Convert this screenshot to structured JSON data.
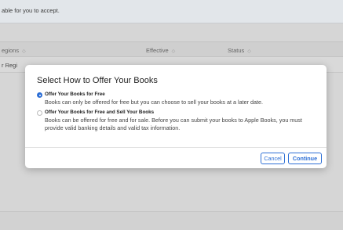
{
  "background": {
    "notice_text": "able for you to accept.",
    "columns": [
      {
        "label": "egions",
        "sort_icon": "◇"
      },
      {
        "label": "Effective",
        "sort_icon": "◇"
      },
      {
        "label": "Status",
        "sort_icon": "◇"
      }
    ],
    "row_stub_text": "r Regi"
  },
  "modal": {
    "title": "Select How to Offer Your Books",
    "options": [
      {
        "title": "Offer Your Books for Free",
        "description": "Books can only be offered for free but you can choose to sell your books at a later date.",
        "selected": true
      },
      {
        "title": "Offer Your Books for Free and Sell Your Books",
        "description": "Books can be offered for free and for sale. Before you can submit your books to Apple Books, you must provide valid banking details and valid tax information.",
        "selected": false
      }
    ],
    "cancel_label": "Cancel",
    "continue_label": "Continue"
  },
  "colors": {
    "accent": "#2d6fd6",
    "overlay": "#d6d6d6"
  }
}
